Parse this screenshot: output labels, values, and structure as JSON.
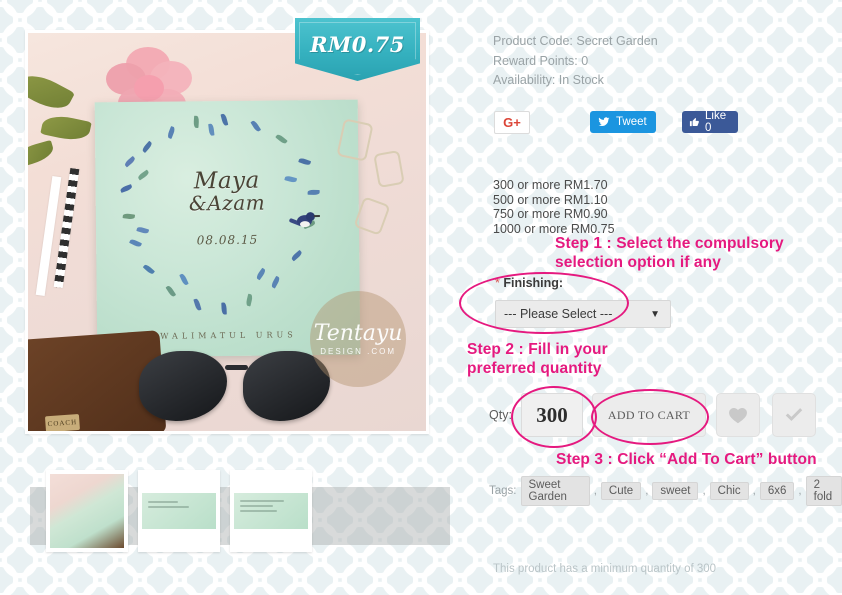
{
  "product": {
    "meta": [
      "Product Code: Secret Garden",
      "Reward Points: 0",
      "Availability: In Stock"
    ],
    "price_badge": "RM0.75",
    "card_name_line1": "Maya",
    "card_name_line2": "&Azam",
    "card_date": "08.08.15",
    "card_subtitle": "WALIMATUL URUS",
    "watermark_name": "Tentayu",
    "watermark_sub": "DESIGN .COM",
    "wallet_brand": "COACH"
  },
  "social": {
    "google_label": "G+",
    "tweet_label": "Tweet",
    "facebook_label": "Like 0"
  },
  "pricing_tiers": [
    "300 or more RM1.70",
    "500 or more RM1.10",
    "750 or more RM0.90",
    "1000 or more RM0.75"
  ],
  "options": {
    "required_mark": "*",
    "finishing_label": "Finishing:",
    "finishing_value": "--- Please Select ---",
    "caret": "▼"
  },
  "cart": {
    "qty_label": "Qty:",
    "qty_value": "300",
    "add_to_cart_label": "ADD TO CART",
    "wishlist_icon": "heart-icon",
    "compare_icon": "check-icon"
  },
  "tags": {
    "label": "Tags:",
    "items": [
      "Sweet Garden",
      "Cute",
      "sweet",
      "Chic",
      "6x6",
      "2 fold"
    ],
    "separator": ","
  },
  "footer_note": "This product has a minimum quantity of 300",
  "annotations": {
    "step1_line1": "Step 1 : Select the compulsory",
    "step1_line2": "selection option if any",
    "step2_line1": "Step 2 : Fill in your",
    "step2_line2": "preferred quantity",
    "step3": "Step 3 : Click “Add To Cart” button",
    "color": "#e5197f"
  },
  "colors": {
    "background": "#e9f1f3",
    "ribbon": "#35b1bf",
    "twitter": "#1b95e0",
    "facebook": "#3b5998",
    "google": "#db4437",
    "required_star": "#d9534f"
  }
}
